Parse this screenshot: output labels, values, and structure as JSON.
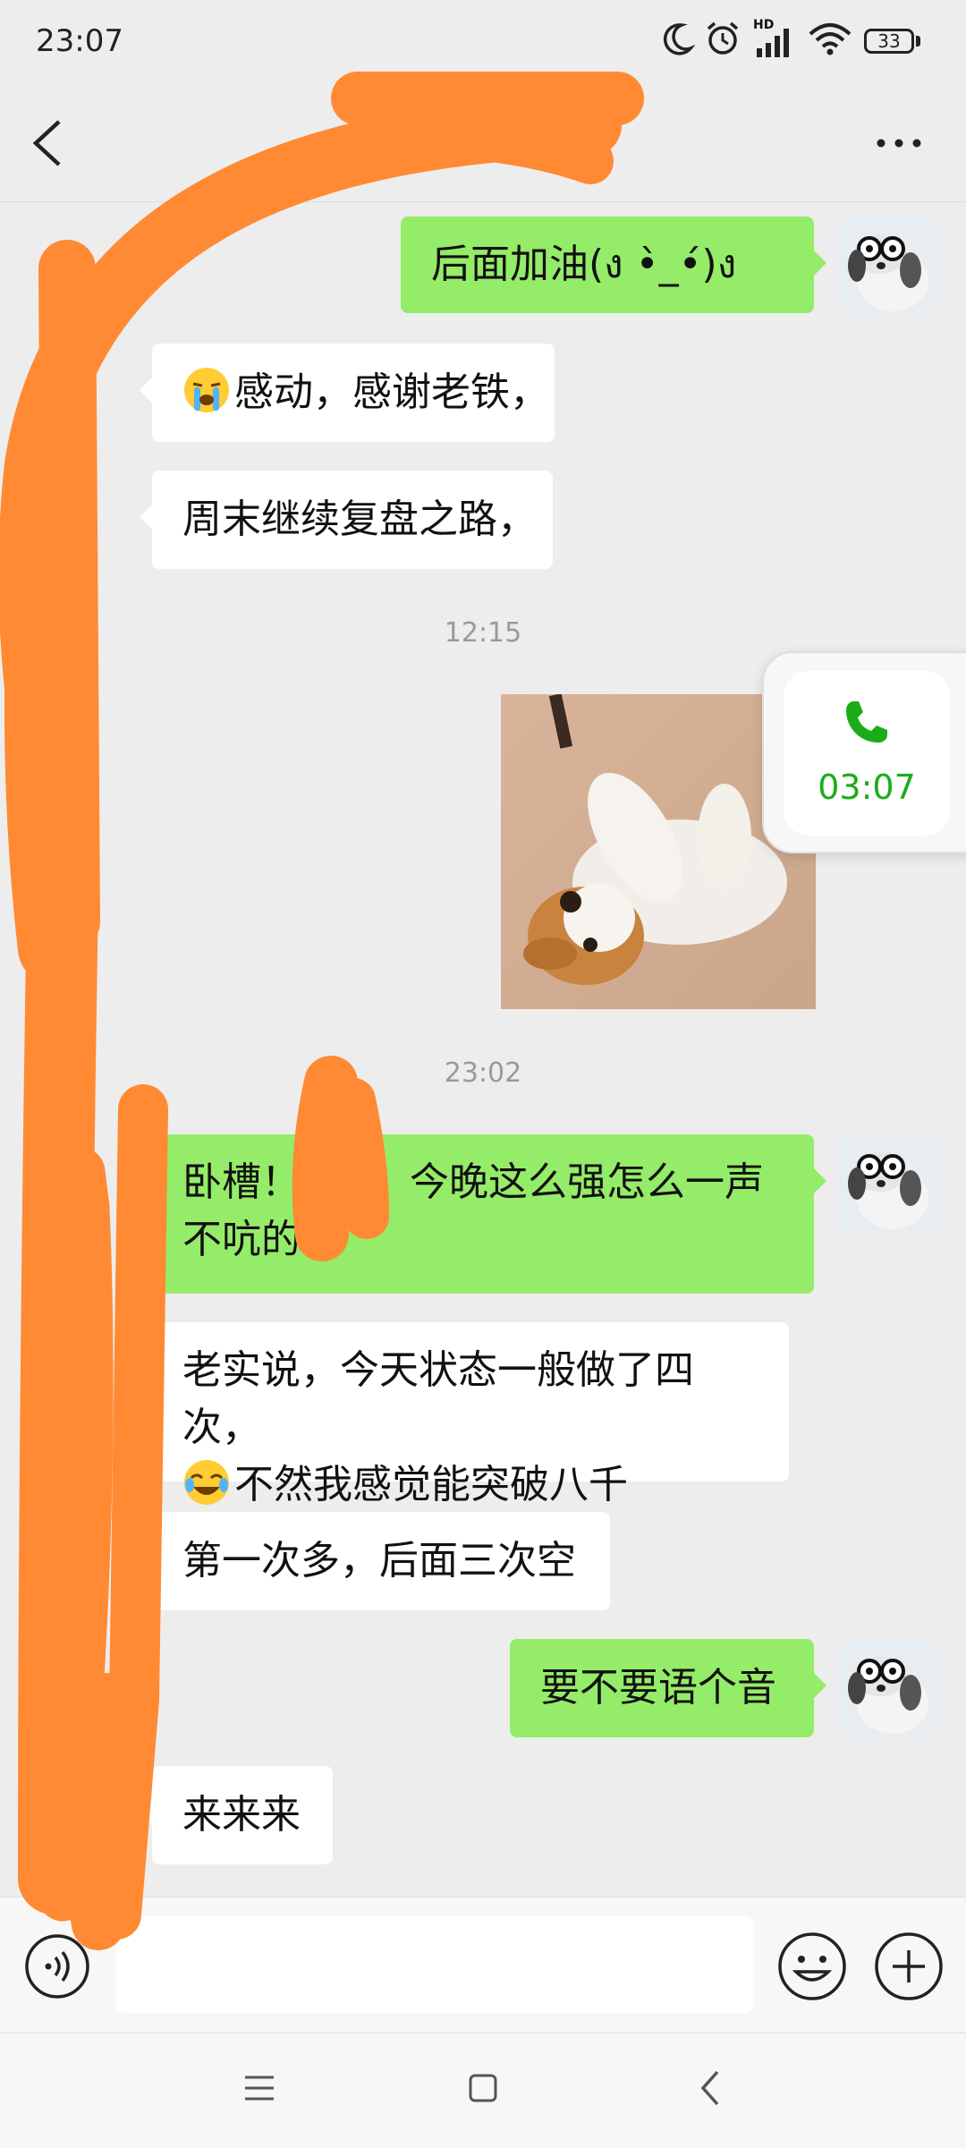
{
  "status_bar": {
    "time": "23:07",
    "network": "HD",
    "battery": "33"
  },
  "header": {
    "back_icon": "chevron-left-icon",
    "more_icon": "more-dots-icon"
  },
  "messages": [
    {
      "side": "out",
      "text": "后面加油(ง •̀_•́)ง"
    },
    {
      "side": "in",
      "emoji": "crying-face",
      "text": "感动，感谢老铁，"
    },
    {
      "side": "in",
      "text": "周末继续复盘之路，"
    },
    {
      "type": "timestamp",
      "text": "12:15"
    },
    {
      "side": "out",
      "type": "image",
      "description": "puppy-photo"
    },
    {
      "type": "timestamp",
      "text": "23:02"
    },
    {
      "side": "out",
      "line1": "卧槽！",
      "line1b": "！今晚这么强怎么一声",
      "line2": "不吭的"
    },
    {
      "side": "in",
      "line1": "老实说，今天状态一般做了四次，",
      "line2_emoji": "laughing-crying-face",
      "line2": "不然我感觉能突破八千"
    },
    {
      "side": "in",
      "text": "第一次多，后面三次空"
    },
    {
      "side": "out",
      "text": "要不要语个音"
    },
    {
      "side": "in",
      "text": "来来来"
    }
  ],
  "call_widget": {
    "icon": "phone-icon",
    "duration": "03:07",
    "color": "#1aad19"
  },
  "input_bar": {
    "voice_icon": "voice-icon",
    "input_value": "",
    "emoji_icon": "smiley-icon",
    "plus_icon": "plus-icon"
  },
  "system_nav": {
    "menu_icon": "menu-icon",
    "home_icon": "home-square-icon",
    "back_icon": "back-chevron-icon"
  },
  "colors": {
    "background": "#ededed",
    "outgoing_bubble": "#95ec69",
    "incoming_bubble": "#ffffff",
    "scribble": "#ff8a33"
  }
}
